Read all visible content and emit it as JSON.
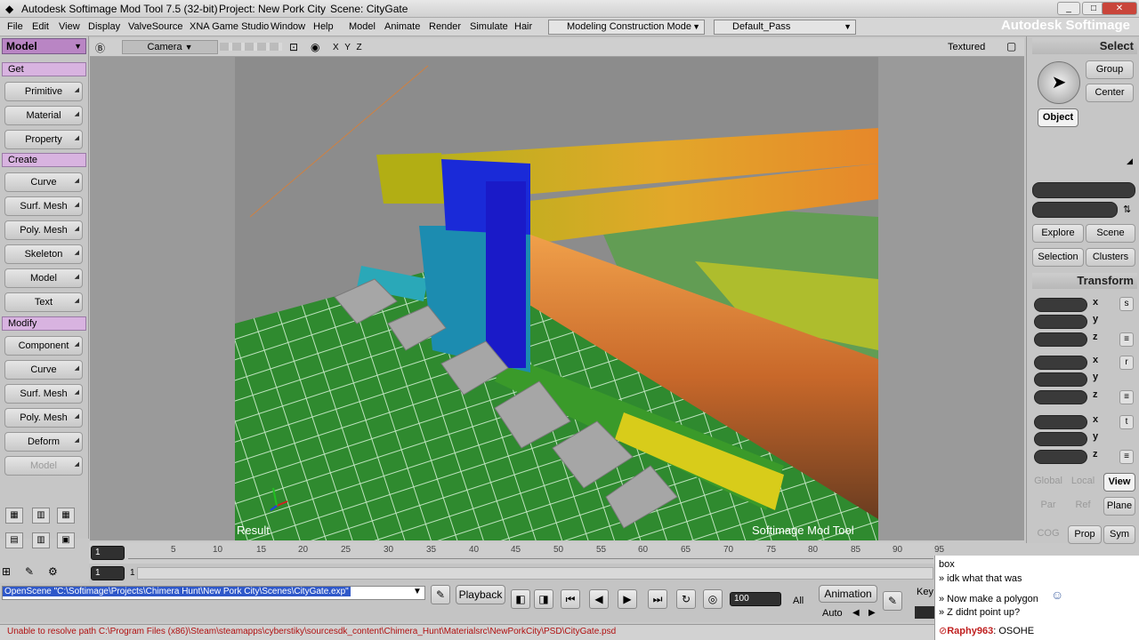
{
  "window": {
    "title": "Autodesk Softimage Mod Tool 7.5 (32-bit)",
    "project": "Project: New Pork City",
    "scene": "Scene: CityGate"
  },
  "menu": [
    "File",
    "Edit",
    "View",
    "Display",
    "ValveSource",
    "XNA Game Studio",
    "Window",
    "Help",
    "Model",
    "Animate",
    "Render",
    "Simulate",
    "Hair"
  ],
  "construction_mode": "Modeling Construction Mode",
  "render_pass": "Default_Pass",
  "brand": "Autodesk Softimage",
  "left": {
    "mode": "Model",
    "get": {
      "title": "Get",
      "items": [
        "Primitive",
        "Material",
        "Property"
      ]
    },
    "create": {
      "title": "Create",
      "items": [
        "Curve",
        "Surf. Mesh",
        "Poly. Mesh",
        "Skeleton",
        "Model",
        "Text"
      ]
    },
    "modify": {
      "title": "Modify",
      "items": [
        "Component",
        "Curve",
        "Surf. Mesh",
        "Poly. Mesh",
        "Deform",
        "Model"
      ]
    }
  },
  "viewport": {
    "camera": "Camera",
    "axes": "X Y Z",
    "display": "Textured",
    "label_left": "Result",
    "label_right": "Softimage  Mod  Tool"
  },
  "right": {
    "select": "Select",
    "group": "Group",
    "center": "Center",
    "object": "Object",
    "explore": "Explore",
    "scene": "Scene",
    "selection": "Selection",
    "clusters": "Clusters",
    "transform": "Transform",
    "axes": [
      "x",
      "y",
      "z"
    ],
    "global": "Global",
    "local": "Local",
    "view": "View",
    "par": "Par",
    "ref": "Ref",
    "plane": "Plane",
    "cog": "COG",
    "prop": "Prop",
    "sym": "Sym"
  },
  "timeline": {
    "ticks": [
      "5",
      "10",
      "15",
      "20",
      "25",
      "30",
      "35",
      "40",
      "45",
      "50",
      "55",
      "60",
      "65",
      "70",
      "75",
      "80",
      "85",
      "90",
      "95"
    ],
    "start": "1",
    "end": "100",
    "frame": "1",
    "frame_label": "1"
  },
  "command": {
    "text": "OpenScene \"C:\\Softimage\\Projects\\Chimera Hunt\\New Pork City\\Scenes\\CityGate.exp\"",
    "playback": "Playback",
    "end_frame": "100",
    "all": "All",
    "animation": "Animation",
    "auto": "Auto",
    "key": "Key"
  },
  "status": "Unable to resolve path  C:\\Program Files (x86)\\Steam\\steamapps\\cyberstiky\\sourcesdk_content\\Chimera_Hunt\\Materialsrc\\NewPorkCity\\PSD\\CityGate.psd",
  "chat": {
    "line1": "box",
    "line2": "» idk what that was",
    "line3": "» Now make a polygon",
    "line4": "» Z didnt point up?",
    "user": "Raphy963",
    "msg": ": OSOHE"
  }
}
